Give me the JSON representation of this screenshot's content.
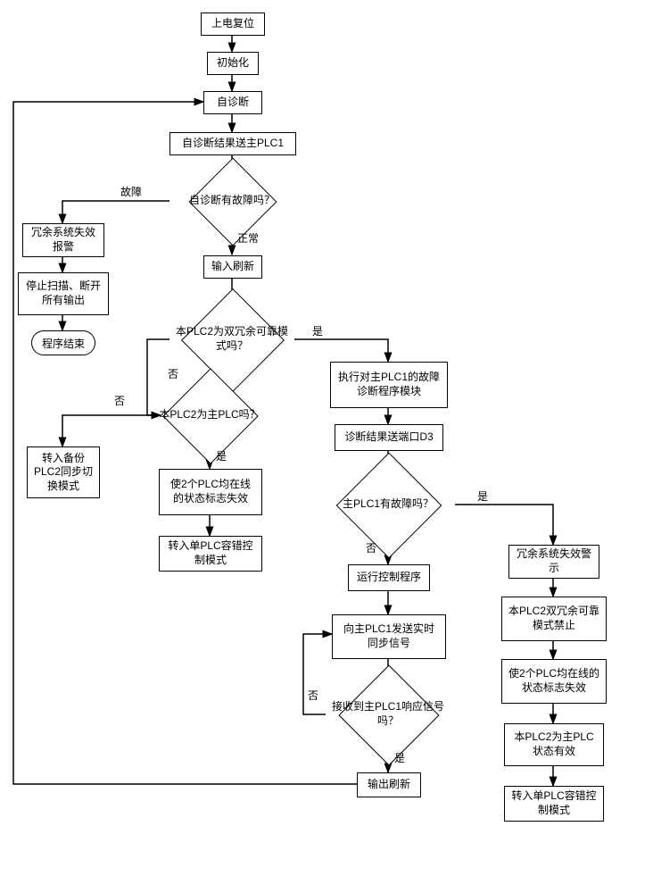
{
  "flowchart": {
    "nodes": {
      "n1": "上电复位",
      "n2": "初始化",
      "n3": "自诊断",
      "n4": "自诊断结果送主PLC1",
      "d1": "自诊断有故障吗？",
      "n5": "冗余系统失效报警",
      "n6": "停止扫描、断开所有输出",
      "t1": "程序结束",
      "n7": "输入刷新",
      "d2": "本PLC2为双冗余可靠模式吗？",
      "d3": "本PLC2为主PLC吗？",
      "n8": "转入备份PLC2同步切换模式",
      "n9": "使2个PLC均在线的状态标志失效",
      "n10": "转入单PLC容错控制模式",
      "n11": "执行对主PLC1的故障诊断程序模块",
      "n12": "诊断结果送端口D3",
      "d4": "主PLC1有故障吗？",
      "n13": "运行控制程序",
      "n14": "向主PLC1发送实时同步信号",
      "d5": "接收到主PLC1响应信号吗？",
      "n15": "输出刷新",
      "n16": "冗余系统失效警示",
      "n17": "本PLC2双冗余可靠模式禁止",
      "n18": "使2个PLC均在线的状态标志失效",
      "n19": "本PLC2为主PLC状态有效",
      "n20": "转入单PLC容错控制模式"
    },
    "labels": {
      "fault": "故障",
      "normal": "正常",
      "yes": "是",
      "no": "否"
    }
  }
}
